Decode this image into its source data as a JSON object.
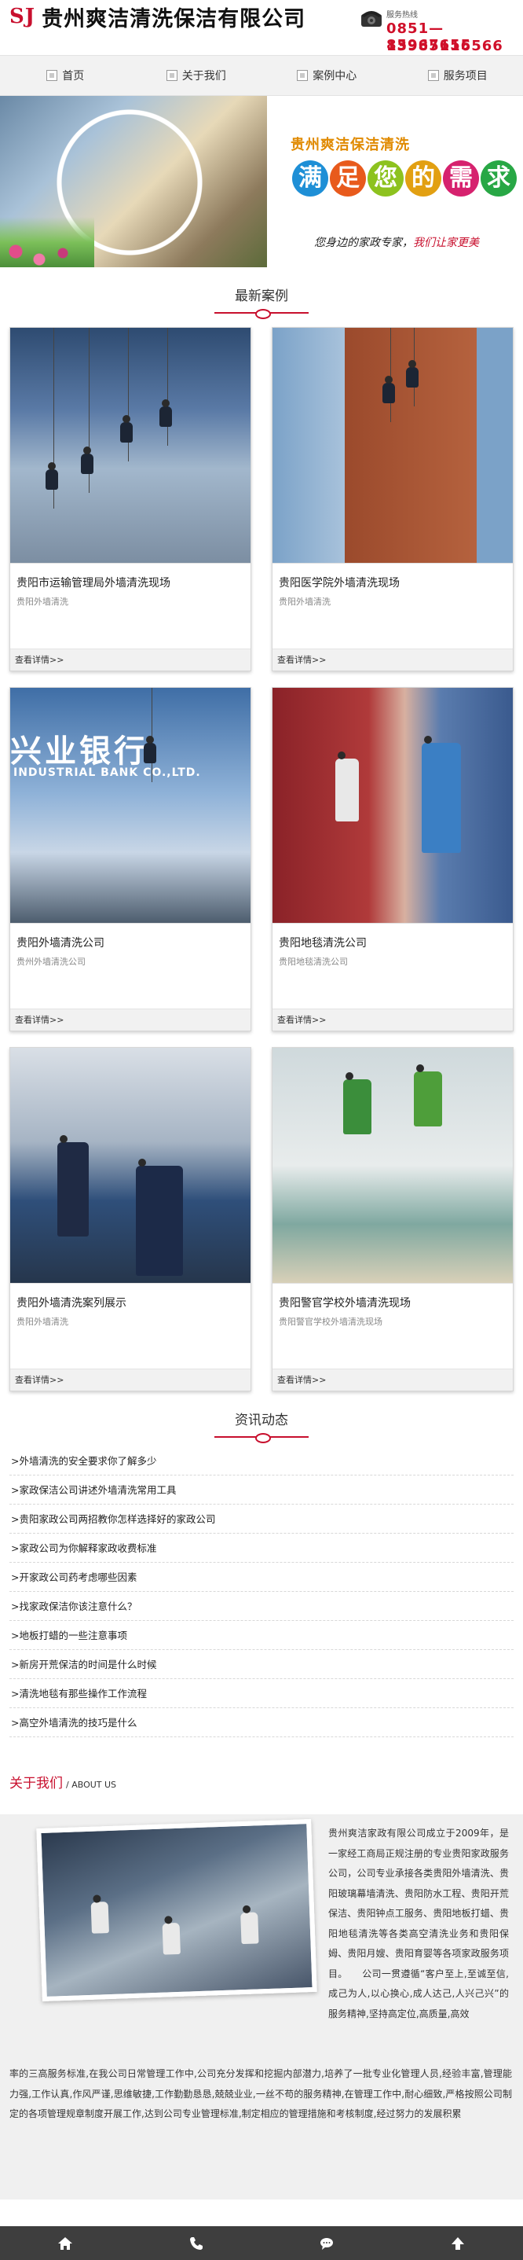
{
  "header": {
    "logo_mark": "SJ",
    "company_name": "贵州爽洁清洗保洁有限公司",
    "hotline_label": "服务热线",
    "phone_1": "0851—85967655",
    "phone_2": "13985116566"
  },
  "nav": {
    "items": [
      {
        "label": "首页"
      },
      {
        "label": "关于我们"
      },
      {
        "label": "案例中心"
      },
      {
        "label": "服务项目"
      }
    ]
  },
  "banner": {
    "title": "贵州爽洁保洁清洗",
    "slogan_chars": [
      "满",
      "足",
      "您",
      "的",
      "需",
      "求"
    ],
    "slogan_colors": [
      "#1e8fd6",
      "#e85a1c",
      "#8dc21f",
      "#e2a012",
      "#d6226e",
      "#28a745"
    ],
    "tagline_a": "您身边的家政专家，",
    "tagline_b": "我们让家更美"
  },
  "cases_section": {
    "title": "最新案例",
    "items": [
      {
        "title": "贵阳市运输管理局外墙清洗现场",
        "subtitle": "贵阳外墙清洗",
        "more": "查看详情>>"
      },
      {
        "title": "贵阳医学院外墙清洗现场",
        "subtitle": "贵阳外墙清洗",
        "more": "查看详情>>"
      },
      {
        "title": "贵阳外墙清洗公司",
        "subtitle": "贵州外墙清洗公司",
        "more": "查看详情>>"
      },
      {
        "title": "贵阳地毯清洗公司",
        "subtitle": "贵阳地毯清洗公司",
        "more": "查看详情>>"
      },
      {
        "title": "贵阳外墙清洗案列展示",
        "subtitle": "贵阳外墙清洗",
        "more": "查看详情>>"
      },
      {
        "title": "贵阳警官学校外墙清洗现场",
        "subtitle": "贵阳警官学校外墙清洗现场",
        "more": "查看详情>>"
      }
    ],
    "overlay_bank_cn": "兴业银行",
    "overlay_bank_en": "INDUSTRIAL BANK CO.,LTD."
  },
  "news_section": {
    "title": "资讯动态",
    "items": [
      ">外墙清洗的安全要求你了解多少",
      ">家政保洁公司讲述外墙清洗常用工具",
      ">贵阳家政公司两招教你怎样选择好的家政公司",
      ">家政公司为你解释家政收费标准",
      ">开家政公司药考虑哪些因素",
      ">找家政保洁你该注意什么？",
      ">地板打蜡的一些注意事项",
      ">新房开荒保洁的时间是什么时候",
      ">清洗地毯有那些操作工作流程",
      ">高空外墙清洗的技巧是什么"
    ]
  },
  "about_section": {
    "title_cn": "关于我们",
    "title_en": "/ ABOUT US",
    "text_right": "贵州爽洁家政有限公司成立于2009年，是一家经工商局正规注册的专业贵阳家政服务公司，公司专业承接各类贵阳外墙清洗、贵阳玻璃幕墙清洗、贵阳防水工程、贵阳开荒保洁、贵阳钟点工服务、贵阳地板打蜡、贵阳地毯清洗等各类高空清洗业务和贵阳保姆、贵阳月嫂、贵阳育婴等各项家政服务项目。　　公司一贯遵循“客户至上,至诚至信,成己为人,以心换心,成人达己,人兴己兴”的服务精神,坚持高定位,高质量,高效",
    "text_full": "率的三高服务标准,在我公司日常管理工作中,公司充分发挥和挖掘内部潜力,培养了一批专业化管理人员,经验丰富,管理能力强,工作认真,作风严谨,思维敏捷,工作勤勤恳恳,兢兢业业,一丝不苟的服务精神,在管理工作中,耐心细致,严格按照公司制定的各项管理规章制度开展工作,达到公司专业管理标准,制定相应的管理措施和考核制度,经过努力的发展积累"
  },
  "bottom_bar": {
    "items": [
      "home-icon",
      "phone-icon",
      "message-icon",
      "top-arrow-icon"
    ]
  }
}
